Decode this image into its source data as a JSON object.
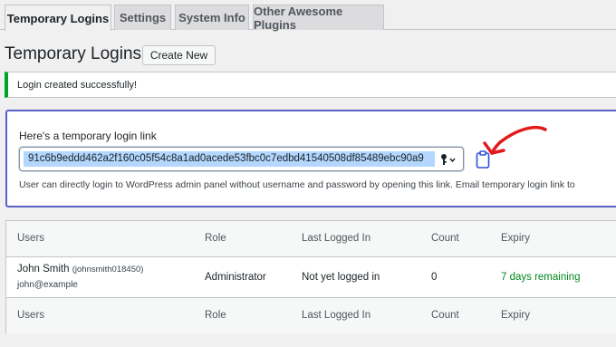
{
  "tabs": [
    {
      "label": "Temporary Logins",
      "active": true
    },
    {
      "label": "Settings",
      "active": false
    },
    {
      "label": "System Info",
      "active": false
    },
    {
      "label": "Other Awesome Plugins",
      "active": false
    }
  ],
  "page": {
    "title": "Temporary Logins",
    "create_button": "Create New"
  },
  "notice": {
    "text": "Login created successfully!",
    "color": "#00a32a"
  },
  "link_box": {
    "label": "Here's a temporary login link",
    "link_value": "91c6b9eddd462a2f160c05f54c8a1ad0acede53fbc0c7edbd41540508df85489ebc90a9",
    "description": "User can directly login to WordPress admin panel without username and password by opening this link. Email temporary login link to",
    "border_color": "#5b5fc7"
  },
  "table": {
    "headers": {
      "users": "Users",
      "role": "Role",
      "last_logged_in": "Last Logged In",
      "count": "Count",
      "expiry": "Expiry"
    },
    "rows": [
      {
        "name": "John Smith",
        "login": "(johnsmith018450)",
        "email": "john@example",
        "role": "Administrator",
        "last_logged_in": "Not yet logged in",
        "count": "0",
        "expiry": "7 days remaining"
      }
    ]
  },
  "icons": {
    "key": "key-icon",
    "clipboard": "clipboard-icon",
    "annotation": "red-arrow"
  }
}
